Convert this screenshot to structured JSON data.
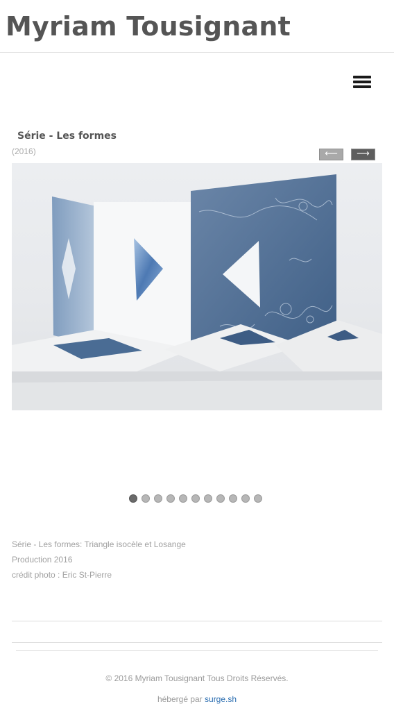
{
  "header": {
    "site_title": "Myriam Tousignant"
  },
  "menu": {
    "icon": "hamburger-menu-icon"
  },
  "artwork": {
    "title": "Série - Les formes",
    "year": "(2016)",
    "prev_glyph": "⟵",
    "next_glyph": "⟶"
  },
  "slideshow": {
    "total": 11,
    "active_index": 1
  },
  "caption": {
    "line1": "Série - Les formes: Triangle isocèle et Losange",
    "line2": "Production 2016",
    "line3": "crédit photo : Eric St-Pierre"
  },
  "footer": {
    "copyright": "© 2016 Myriam Tousignant Tous Droits Réservés.",
    "hosted_prefix": "hébergé par",
    "hosted_link": "surge.sh"
  },
  "colors": {
    "title_text": "#555555",
    "link": "#2a6db0",
    "paper_blue": "#4f6f96"
  }
}
